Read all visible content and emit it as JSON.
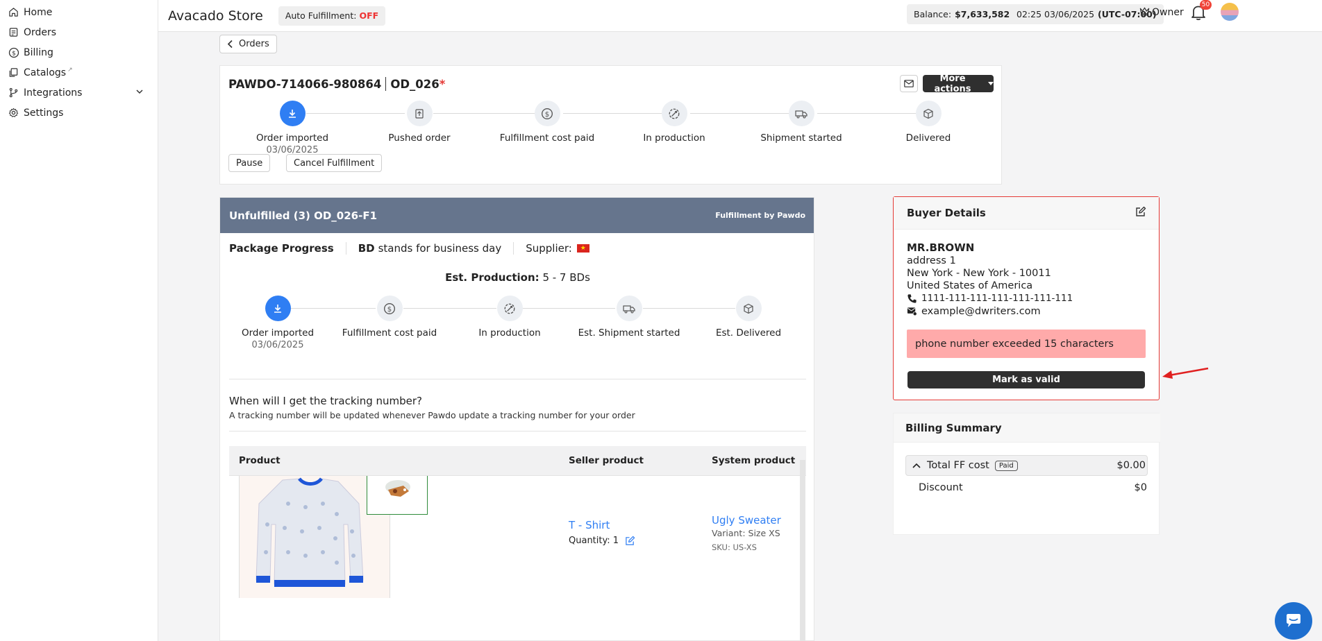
{
  "sidebar": {
    "items": [
      {
        "label": "Home",
        "icon": "home-icon"
      },
      {
        "label": "Orders",
        "icon": "orders-icon"
      },
      {
        "label": "Billing",
        "icon": "dollar-icon"
      },
      {
        "label": "Catalogs",
        "icon": "catalog-icon",
        "external": "↗"
      },
      {
        "label": "Integrations",
        "icon": "branch-icon"
      },
      {
        "label": "Settings",
        "icon": "gear-icon"
      }
    ]
  },
  "header": {
    "store_name": "Avacado Store",
    "auto_fulfillment_label": "Auto Fulfillment:",
    "auto_fulfillment_value": "OFF",
    "balance_label": "Balance:",
    "balance_value": "$7,633,582.53",
    "datetime": "02:25 03/06/2025",
    "timezone": "(UTC-07:00)",
    "role": "Owner",
    "notification_count": "50"
  },
  "back_button": "Orders",
  "order": {
    "id": "PAWDO-714066-980864",
    "ref": "OD_026",
    "required_mark": "*",
    "more_actions": "More actions",
    "steps": [
      {
        "label": "Order imported",
        "date": "03/06/2025",
        "icon": "download-icon"
      },
      {
        "label": "Pushed order",
        "date": "",
        "icon": "push-icon"
      },
      {
        "label": "Fulfillment cost paid",
        "date": "",
        "icon": "dollar-icon"
      },
      {
        "label": "In production",
        "date": "",
        "icon": "production-icon"
      },
      {
        "label": "Shipment started",
        "date": "",
        "icon": "truck-icon"
      },
      {
        "label": "Delivered",
        "date": "",
        "icon": "box-icon"
      }
    ],
    "pause": "Pause",
    "cancel": "Cancel Fulfillment"
  },
  "package": {
    "header_title": "Unfulfilled (3) OD_026-F1",
    "header_right": "Fulfillment by Pawdo",
    "progress_label": "Package Progress",
    "bd_abbr": "BD",
    "bd_text": "stands for business day",
    "supplier_label": "Supplier:",
    "est_label": "Est. Production:",
    "est_value": "5 - 7 BDs",
    "steps": [
      {
        "label": "Order imported",
        "date": "03/06/2025",
        "icon": "download-icon"
      },
      {
        "label": "Fulfillment cost paid",
        "date": "",
        "icon": "dollar-icon"
      },
      {
        "label": "In production",
        "date": "",
        "icon": "production-icon"
      },
      {
        "label": "Est. Shipment started",
        "date": "",
        "icon": "truck-icon"
      },
      {
        "label": "Est. Delivered",
        "date": "",
        "icon": "box-icon"
      }
    ],
    "tracking_q": "When will I get the tracking number?",
    "tracking_a": "A tracking number will be updated whenever Pawdo update a tracking number for your order",
    "table": {
      "headers": [
        "Product",
        "Seller product",
        "System product"
      ],
      "row": {
        "seller_product": "T - Shirt",
        "quantity": "Quantity: 1",
        "system_product": "Ugly Sweater",
        "variant": "Variant: Size XS",
        "sku": "SKU: US-XS"
      }
    }
  },
  "buyer": {
    "title": "Buyer Details",
    "name": "MR.BROWN",
    "address": "address 1",
    "city": "New York - New York - 10011",
    "country": "United States of America",
    "phone": "1111-111-111-111-111-111-111",
    "email": "example@dwriters.com",
    "error": "phone number exceeded 15 characters",
    "mark_valid": "Mark as valid"
  },
  "billing": {
    "title": "Billing Summary",
    "total_label": "Total FF cost",
    "paid_badge": "Paid",
    "total_value": "$0.00",
    "discount_label": "Discount",
    "discount_value": "$0"
  },
  "colors": {
    "accent": "#2f7ef3",
    "package_header": "#66758d",
    "error_bg": "#ffaaaa",
    "buyer_border": "#e53935",
    "off": "#ee3333",
    "dark_button": "#2f2f2f"
  }
}
